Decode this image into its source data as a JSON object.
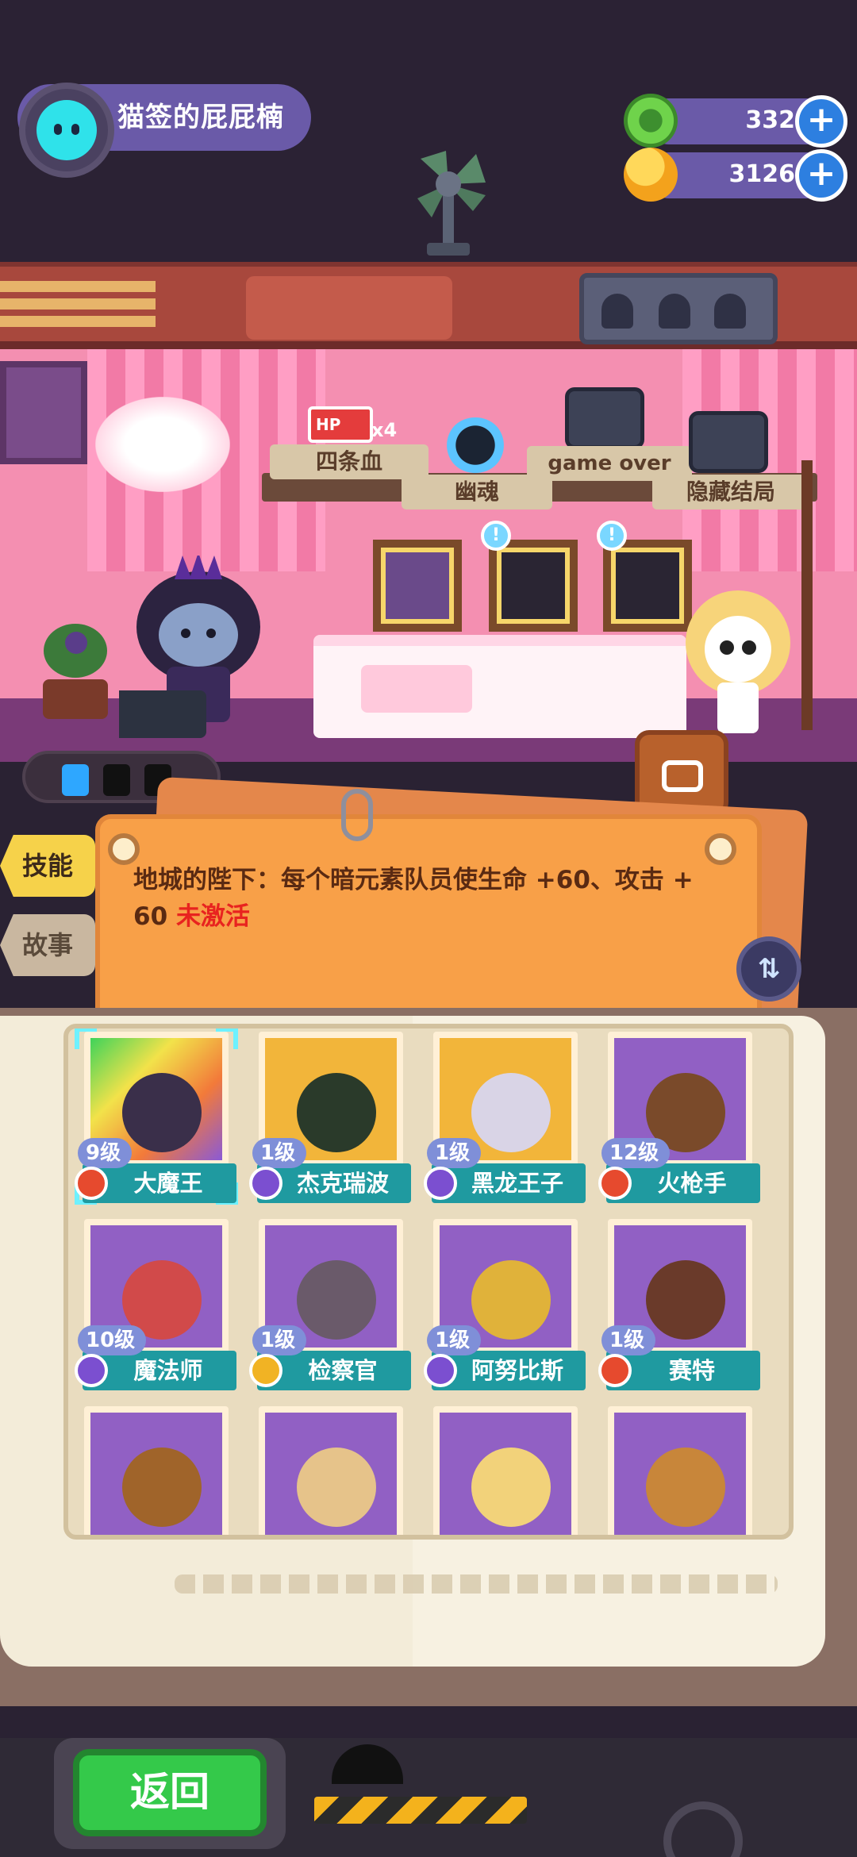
{
  "profile": {
    "name": "猫签的屁屁楠"
  },
  "currency": {
    "gems": "332",
    "coins": "3126",
    "add_symbol": "+"
  },
  "room": {
    "signs": {
      "four_hp": "四条血",
      "ghost": "幽魂",
      "game_over": "game over",
      "hidden_ending": "隐藏结局"
    },
    "hp_badge": "HP",
    "hp_multiplier": "x4",
    "alert_symbol": "!"
  },
  "tabs": {
    "skill": "技能",
    "story": "故事"
  },
  "skill_panel": {
    "description": "地城的陛下：每个暗元素队员使生命 +60、攻击 + 60",
    "status": "未激活",
    "toggle_symbol": "⇅"
  },
  "heroes": [
    {
      "name": "大魔王",
      "level": "9级",
      "badge": "red",
      "portrait": "rainbow",
      "selected": true
    },
    {
      "name": "杰克瑞波",
      "level": "1级",
      "badge": "purple",
      "portrait": "gold",
      "selected": false
    },
    {
      "name": "黑龙王子",
      "level": "1级",
      "badge": "purple",
      "portrait": "gold",
      "selected": false
    },
    {
      "name": "火枪手",
      "level": "12级",
      "badge": "red",
      "portrait": "purple",
      "selected": false
    },
    {
      "name": "魔法师",
      "level": "10级",
      "badge": "purple",
      "portrait": "purple",
      "selected": false
    },
    {
      "name": "检察官",
      "level": "1级",
      "badge": "gold",
      "portrait": "purple",
      "selected": false
    },
    {
      "name": "阿努比斯",
      "level": "1级",
      "badge": "purple",
      "portrait": "purple",
      "selected": false
    },
    {
      "name": "赛特",
      "level": "1级",
      "badge": "red",
      "portrait": "purple",
      "selected": false
    },
    {
      "name": "",
      "level": "",
      "badge": "",
      "portrait": "purple",
      "selected": false
    },
    {
      "name": "",
      "level": "",
      "badge": "",
      "portrait": "purple",
      "selected": false
    },
    {
      "name": "",
      "level": "",
      "badge": "",
      "portrait": "purple",
      "selected": false
    },
    {
      "name": "",
      "level": "",
      "badge": "",
      "portrait": "purple",
      "selected": false
    }
  ],
  "bottom": {
    "back_label": "返回"
  },
  "colors": {
    "accent_teal": "#1f9aa0",
    "panel_orange": "#f8a048",
    "status_red": "#e8231f",
    "back_green": "#34c94a"
  }
}
